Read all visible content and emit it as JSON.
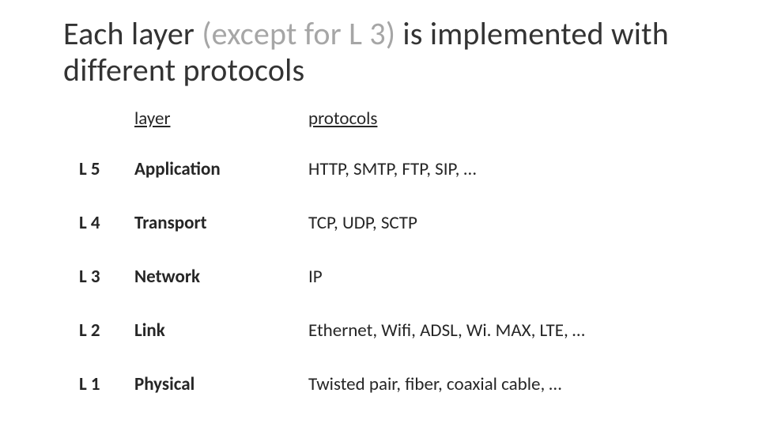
{
  "title": {
    "part1": "Each layer ",
    "gray": "(except for L 3)",
    "part2": " is implemented with different protocols"
  },
  "headers": {
    "layer": "layer",
    "protocols": "protocols"
  },
  "rows": [
    {
      "level": "L 5",
      "layer": "Application",
      "protocols": "HTTP, SMTP, FTP, SIP, …"
    },
    {
      "level": "L 4",
      "layer": "Transport",
      "protocols": "TCP, UDP, SCTP"
    },
    {
      "level": "L 3",
      "layer": "Network",
      "protocols": "IP"
    },
    {
      "level": "L 2",
      "layer": "Link",
      "protocols": "Ethernet, Wifi, ADSL, Wi. MAX, LTE, …"
    },
    {
      "level": "L 1",
      "layer": "Physical",
      "protocols": "Twisted pair, fiber, coaxial cable, …"
    }
  ],
  "chart_data": {
    "type": "table",
    "title": "Each layer (except for L 3) is implemented with different protocols",
    "columns": [
      "level",
      "layer",
      "protocols"
    ],
    "rows": [
      [
        "L 5",
        "Application",
        "HTTP, SMTP, FTP, SIP, …"
      ],
      [
        "L 4",
        "Transport",
        "TCP, UDP, SCTP"
      ],
      [
        "L 3",
        "Network",
        "IP"
      ],
      [
        "L 2",
        "Link",
        "Ethernet, Wifi, ADSL, Wi. MAX, LTE, …"
      ],
      [
        "L 1",
        "Physical",
        "Twisted pair, fiber, coaxial cable, …"
      ]
    ]
  }
}
